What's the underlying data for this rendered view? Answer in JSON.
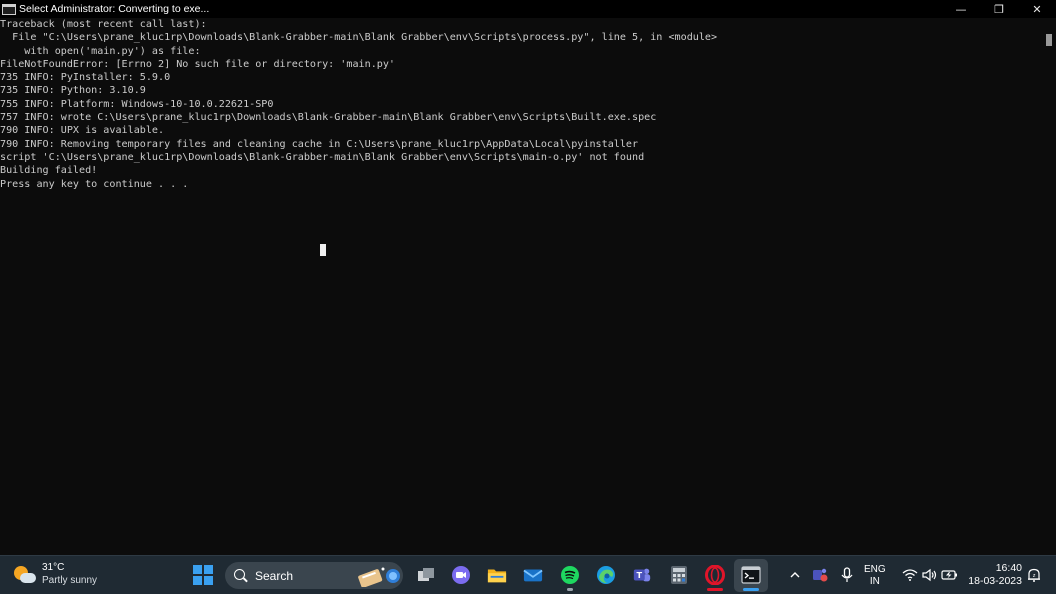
{
  "window": {
    "title": "Select Administrator:  Converting to exe...",
    "minimize_glyph": "—",
    "restore_glyph": "❐",
    "close_glyph": "✕"
  },
  "console": {
    "lines": [
      "Traceback (most recent call last):",
      "  File \"C:\\Users\\prane_kluc1rp\\Downloads\\Blank-Grabber-main\\Blank Grabber\\env\\Scripts\\process.py\", line 5, in <module>",
      "    with open('main.py') as file:",
      "FileNotFoundError: [Errno 2] No such file or directory: 'main.py'",
      "735 INFO: PyInstaller: 5.9.0",
      "735 INFO: Python: 3.10.9",
      "755 INFO: Platform: Windows-10-10.0.22621-SP0",
      "757 INFO: wrote C:\\Users\\prane_kluc1rp\\Downloads\\Blank-Grabber-main\\Blank Grabber\\env\\Scripts\\Built.exe.spec",
      "790 INFO: UPX is available.",
      "790 INFO: Removing temporary files and cleaning cache in C:\\Users\\prane_kluc1rp\\AppData\\Local\\pyinstaller",
      "script 'C:\\Users\\prane_kluc1rp\\Downloads\\Blank-Grabber-main\\Blank Grabber\\env\\Scripts\\main-o.py' not found",
      "Building failed!",
      "Press any key to continue . . ."
    ]
  },
  "taskbar": {
    "weather": {
      "temp": "31°C",
      "condition": "Partly sunny",
      "icon": "partly-sunny-icon"
    },
    "search_label": "Search",
    "apps": [
      {
        "name": "task-view-icon"
      },
      {
        "name": "chat-icon"
      },
      {
        "name": "file-explorer-icon"
      },
      {
        "name": "mail-icon"
      },
      {
        "name": "spotify-icon"
      },
      {
        "name": "edge-icon"
      },
      {
        "name": "teams-icon"
      },
      {
        "name": "calculator-icon"
      },
      {
        "name": "opera-icon"
      },
      {
        "name": "terminal-icon"
      }
    ],
    "tray": {
      "lang_top": "ENG",
      "lang_bottom": "IN",
      "time": "16:40",
      "date": "18-03-2023"
    }
  },
  "colors": {
    "console_bg": "#0c0c0c",
    "console_text": "#cccccc",
    "taskbar_bg": "#1f2a33",
    "accent": "#3aa0f0",
    "spotify": "#1ed760",
    "opera": "#e0152a"
  }
}
